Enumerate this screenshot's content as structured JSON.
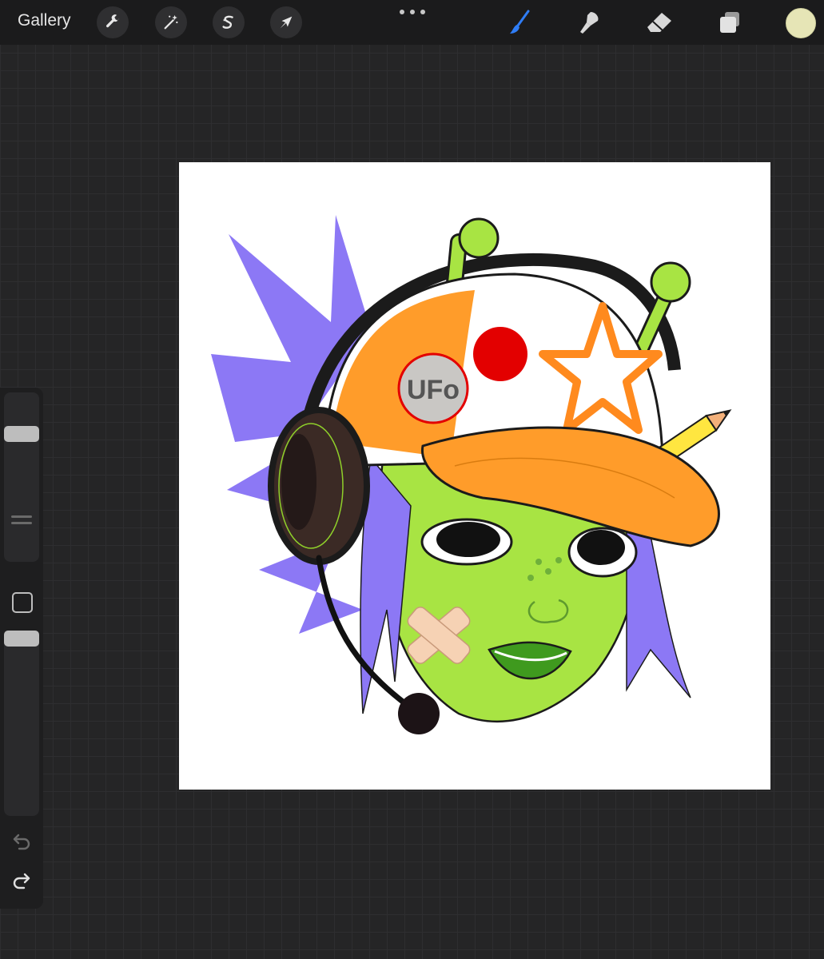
{
  "toolbar": {
    "gallery_label": "Gallery",
    "left_tools": [
      {
        "name": "actions",
        "icon": "wrench-icon"
      },
      {
        "name": "adjustments",
        "icon": "magic-wand-icon"
      },
      {
        "name": "selection",
        "icon": "selection-s-icon"
      },
      {
        "name": "transform",
        "icon": "cursor-arrow-icon"
      }
    ],
    "right_tools": [
      {
        "name": "brush",
        "icon": "brush-icon",
        "active": true
      },
      {
        "name": "smudge",
        "icon": "smudge-icon"
      },
      {
        "name": "eraser",
        "icon": "eraser-icon"
      },
      {
        "name": "layers",
        "icon": "layers-icon"
      }
    ],
    "more_icon": "more-dots-icon",
    "active_color": "#e6e5b6",
    "accent_color": "#2f7df6"
  },
  "sidebar": {
    "brush_size_level": 0.78,
    "opacity_level": 1.0,
    "modify_button_icon": "square-icon",
    "undo_icon": "undo-icon",
    "redo_icon": "redo-icon"
  },
  "artwork": {
    "cap_badge_text": "UFo"
  }
}
